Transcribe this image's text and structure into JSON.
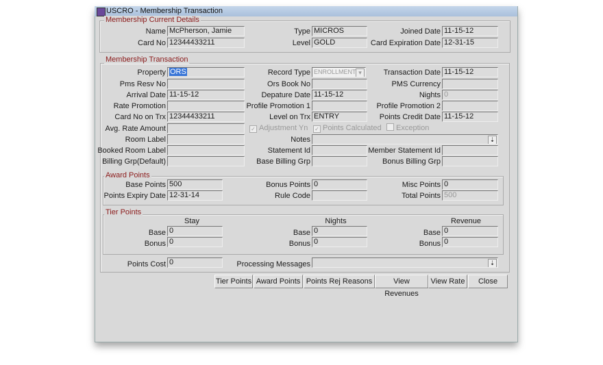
{
  "window": {
    "title": "USCRO - Membership Transaction"
  },
  "current": {
    "legend": "Membership Current Details",
    "name_label": "Name",
    "name": "McPherson, Jamie",
    "type_label": "Type",
    "type": "MICROS",
    "joined_label": "Joined Date",
    "joined": "11-15-12",
    "card_label": "Card No",
    "card": "12344433211",
    "level_label": "Level",
    "level": "GOLD",
    "exp_label": "Card Expiration Date",
    "exp": "12-31-15"
  },
  "trx": {
    "legend": "Membership Transaction",
    "property_label": "Property",
    "property": "ORS",
    "record_type_label": "Record Type",
    "record_type": "ENROLLMENT",
    "trx_date_label": "Transaction Date",
    "trx_date": "11-15-12",
    "pms_resv_label": "Pms Resv No",
    "pms_resv": "",
    "ors_book_label": "Ors Book No",
    "ors_book": "",
    "pms_currency_label": "PMS Currency",
    "pms_currency": "",
    "arrival_label": "Arrival Date",
    "arrival": "11-15-12",
    "departure_label": "Depature Date",
    "departure": "11-15-12",
    "nights_label": "Nights",
    "nights": "0",
    "rate_promo_label": "Rate Promotion",
    "rate_promo": "",
    "profile_promo1_label": "Profile Promotion 1",
    "profile_promo1": "",
    "profile_promo2_label": "Profile Promotion 2",
    "profile_promo2": "",
    "card_trx_label": "Card No on Trx",
    "card_trx": "12344433211",
    "level_trx_label": "Level on Trx",
    "level_trx": "ENTRY",
    "credit_date_label": "Points Credit Date",
    "credit_date": "11-15-12",
    "avg_rate_label": "Avg. Rate Amount",
    "avg_rate": "",
    "adjustment_label": "Adjustment Yn",
    "points_calc_label": "Points Calculated",
    "exception_label": "Exception",
    "room_label_label": "Room Label",
    "room_label": "",
    "notes_label": "Notes",
    "notes": "",
    "booked_room_label": "Booked Room Label",
    "booked_room": "",
    "statement_label": "Statement Id",
    "statement": "",
    "member_statement_label": "Member Statement Id",
    "member_statement": "",
    "billing_default_label": "Billing Grp(Default)",
    "billing_default": "",
    "base_billing_label": "Base Billing Grp",
    "base_billing": "",
    "bonus_billing_label": "Bonus Billing Grp",
    "bonus_billing": ""
  },
  "award": {
    "legend": "Award Points",
    "base_label": "Base Points",
    "base": "500",
    "bonus_label": "Bonus Points",
    "bonus": "0",
    "misc_label": "Misc Points",
    "misc": "0",
    "expiry_label": "Points Expiry Date",
    "expiry": "12-31-14",
    "rule_label": "Rule Code",
    "rule": "",
    "total_label": "Total Points",
    "total": "500"
  },
  "tier": {
    "legend": "Tier Points",
    "stay": "Stay",
    "nights": "Nights",
    "revenue": "Revenue",
    "base_label": "Base",
    "bonus_label": "Bonus",
    "stay_base": "0",
    "stay_bonus": "0",
    "nights_base": "0",
    "nights_bonus": "0",
    "revenue_base": "0",
    "revenue_bonus": "0"
  },
  "footer": {
    "points_cost_label": "Points Cost",
    "points_cost": "0",
    "processing_label": "Processing Messages",
    "processing": ""
  },
  "buttons": [
    "Tier Points",
    "Award Points",
    "Points Rej Reasons",
    "View Revenues",
    "View Rate",
    "Close"
  ]
}
